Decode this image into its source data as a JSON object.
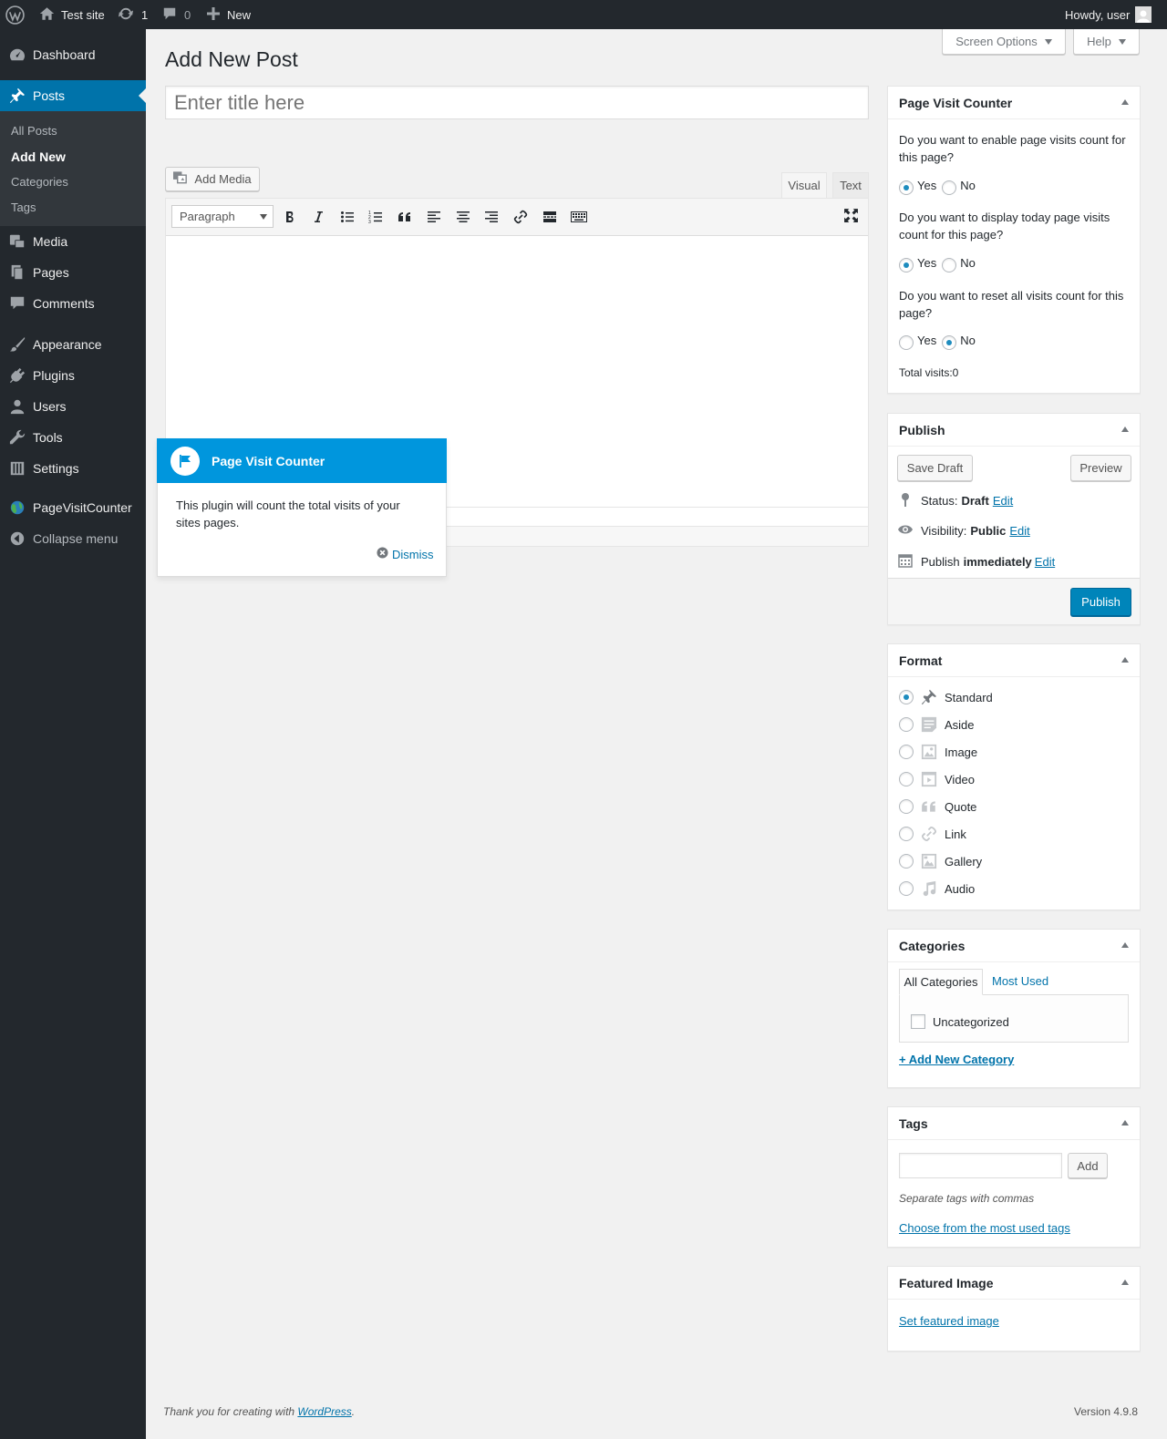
{
  "admin_bar": {
    "site_name": "Test site",
    "updates_count": "1",
    "comments_count": "0",
    "new_label": "New",
    "howdy": "Howdy, user"
  },
  "sidebar": {
    "items": [
      {
        "label": "Dashboard",
        "icon": "dashboard-icon"
      },
      {
        "label": "Posts",
        "icon": "pin-icon"
      },
      {
        "label": "Media",
        "icon": "media-icon"
      },
      {
        "label": "Pages",
        "icon": "pages-icon"
      },
      {
        "label": "Comments",
        "icon": "comment-icon"
      },
      {
        "label": "Appearance",
        "icon": "brush-icon"
      },
      {
        "label": "Plugins",
        "icon": "plugin-icon"
      },
      {
        "label": "Users",
        "icon": "users-icon"
      },
      {
        "label": "Tools",
        "icon": "wrench-icon"
      },
      {
        "label": "Settings",
        "icon": "settings-icon"
      },
      {
        "label": "PageVisitCounter",
        "icon": "globe-icon"
      },
      {
        "label": "Collapse menu",
        "icon": "collapse-icon"
      }
    ],
    "submenu": [
      "All Posts",
      "Add New",
      "Categories",
      "Tags"
    ]
  },
  "screen_options": "Screen Options",
  "help": "Help",
  "page_title": "Add New Post",
  "title_placeholder": "Enter title here",
  "editor": {
    "add_media": "Add Media",
    "tab_visual": "Visual",
    "tab_text": "Text",
    "format_select": "Paragraph"
  },
  "pointer": {
    "title": "Page Visit Counter",
    "body": "This plugin will count the total visits of your sites pages.",
    "dismiss": "Dismiss"
  },
  "pvc_box": {
    "title": "Page Visit Counter",
    "q1": "Do you want to enable page visits count for this page?",
    "q2": "Do you want to display today page visits count for this page?",
    "q3": "Do you want to reset all visits count for this page?",
    "yes": "Yes",
    "no": "No",
    "q1_selected": "Yes",
    "q2_selected": "Yes",
    "q3_selected": "No",
    "total": "Total visits:0"
  },
  "publish": {
    "title": "Publish",
    "save_draft": "Save Draft",
    "preview": "Preview",
    "status_label": "Status:",
    "status_value": "Draft",
    "visibility_label": "Visibility:",
    "visibility_value": "Public",
    "publish_label": "Publish",
    "publish_value": "immediately",
    "edit": "Edit",
    "publish_button": "Publish"
  },
  "format": {
    "title": "Format",
    "selected": "Standard",
    "options": [
      {
        "label": "Standard",
        "icon": "pin-icon"
      },
      {
        "label": "Aside",
        "icon": "aside-icon"
      },
      {
        "label": "Image",
        "icon": "image-icon"
      },
      {
        "label": "Video",
        "icon": "video-icon"
      },
      {
        "label": "Quote",
        "icon": "quote-icon"
      },
      {
        "label": "Link",
        "icon": "link-icon"
      },
      {
        "label": "Gallery",
        "icon": "gallery-icon"
      },
      {
        "label": "Audio",
        "icon": "audio-icon"
      }
    ]
  },
  "categories": {
    "title": "Categories",
    "tab_all": "All Categories",
    "tab_most": "Most Used",
    "items": [
      "Uncategorized"
    ],
    "add_new": "+ Add New Category"
  },
  "tags": {
    "title": "Tags",
    "input_value": "",
    "add": "Add",
    "hint": "Separate tags with commas",
    "choose": "Choose from the most used tags"
  },
  "featured": {
    "title": "Featured Image",
    "link": "Set featured image"
  },
  "footer": {
    "thanks_prefix": "Thank you for creating with ",
    "thanks_link": "WordPress",
    "thanks_suffix": ".",
    "version": "Version 4.9.8"
  },
  "colors": {
    "accent": "#0073aa",
    "admin_bar": "#23282d",
    "pointer_header": "#0096dd",
    "primary_button": "#0085ba"
  }
}
